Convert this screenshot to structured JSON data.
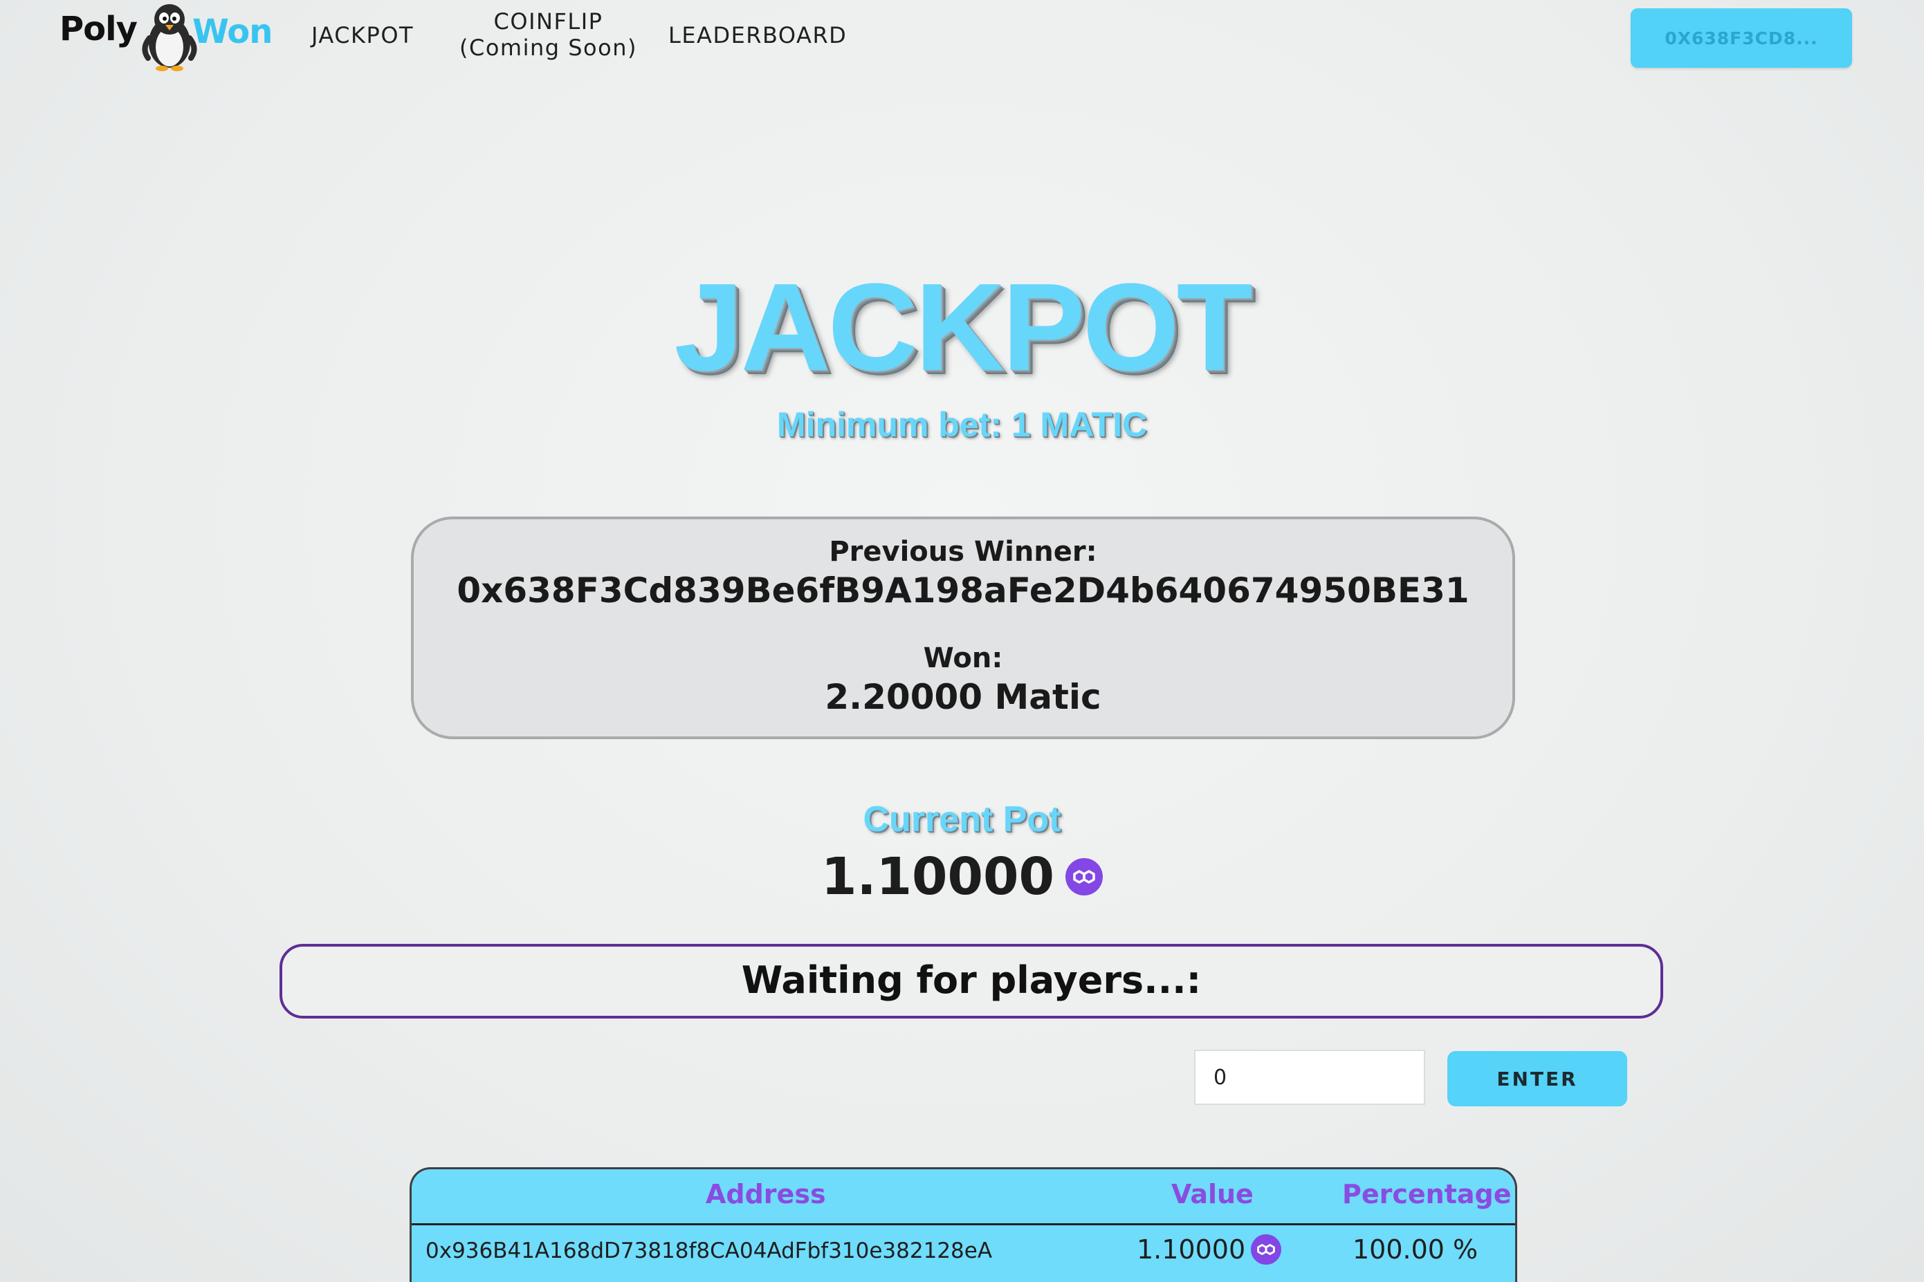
{
  "nav": {
    "logo_left": "Poly",
    "logo_right": "Won",
    "jackpot": "JACKPOT",
    "coinflip_line1": "COINFLIP",
    "coinflip_line2": "(Coming Soon)",
    "leaderboard": "LEADERBOARD",
    "wallet": "0X638F3CD8..."
  },
  "hero": {
    "title": "JACKPOT",
    "min_bet": "Minimum bet: 1 MATIC"
  },
  "previous_winner": {
    "label": "Previous Winner:",
    "address": "0x638F3Cd839Be6fB9A198aFe2D4b640674950BE31",
    "won_label": "Won:",
    "won_value": "2.20000 Matic"
  },
  "pot": {
    "label": "Current Pot",
    "value": "1.10000",
    "icon": "matic-icon"
  },
  "status": {
    "waiting": "Waiting for players...:"
  },
  "bet": {
    "input_value": "0",
    "enter_label": "ENTER"
  },
  "table": {
    "headers": [
      "Address",
      "Value",
      "Percentage"
    ],
    "rows": [
      {
        "address": "0x936B41A168dD73818f8CA04AdFbf310e382128eA",
        "value": "1.10000",
        "percentage": "100.00 %"
      }
    ]
  },
  "colors": {
    "accent": "#55d3f8",
    "purple": "#8a4ce0",
    "matic": "#8247e5"
  }
}
